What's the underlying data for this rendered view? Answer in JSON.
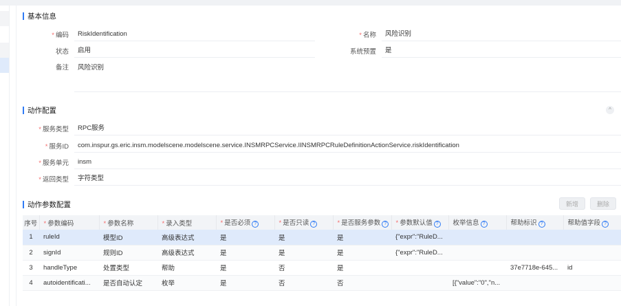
{
  "basic": {
    "title": "基本信息",
    "fields": [
      {
        "label": "编码",
        "value": "RiskIdentification",
        "required": true
      },
      {
        "label": "名称",
        "value": "风险识别",
        "required": true
      },
      {
        "label": "状态",
        "value": "启用",
        "required": false
      },
      {
        "label": "系统预置",
        "value": "是",
        "required": false
      },
      {
        "label": "备注",
        "value": "风险识别",
        "required": false
      }
    ]
  },
  "action": {
    "title": "动作配置",
    "collapse_icon": "chevron-up-icon",
    "fields": [
      {
        "label": "服务类型",
        "value": "RPC服务"
      },
      {
        "label": "服务ID",
        "value": "com.inspur.gs.eric.insm.modelscene.modelscene.service.INSMRPCService.IINSMRPCRuleDefinitionActionService.riskIdentification"
      },
      {
        "label": "服务单元",
        "value": "insm"
      },
      {
        "label": "返回类型",
        "value": "字符类型"
      }
    ]
  },
  "params": {
    "title": "动作参数配置",
    "add_label": "新增",
    "delete_label": "删除",
    "columns": [
      "序号",
      "参数编码",
      "参数名称",
      "录入类型",
      "是否必须",
      "是否只读",
      "是否服务参数",
      "参数默认值",
      "枚举信息",
      "帮助标识",
      "帮助值字段"
    ],
    "help_mark": "?",
    "rows": [
      [
        "1",
        "ruleId",
        "模型ID",
        "高级表达式",
        "是",
        "是",
        "是",
        "{\"expr\":\"RuleD...",
        "",
        "",
        ""
      ],
      [
        "2",
        "signId",
        "规则ID",
        "高级表达式",
        "是",
        "是",
        "是",
        "{\"expr\":\"RuleD...",
        "",
        "",
        ""
      ],
      [
        "3",
        "handleType",
        "处置类型",
        "帮助",
        "是",
        "否",
        "是",
        "",
        "",
        "37e7718e-645...",
        "id"
      ],
      [
        "4",
        "autoidentificati...",
        "是否自动认定",
        "枚举",
        "是",
        "否",
        "否",
        "",
        "[{\"value\":\"0\",\"n...",
        "",
        ""
      ]
    ]
  }
}
